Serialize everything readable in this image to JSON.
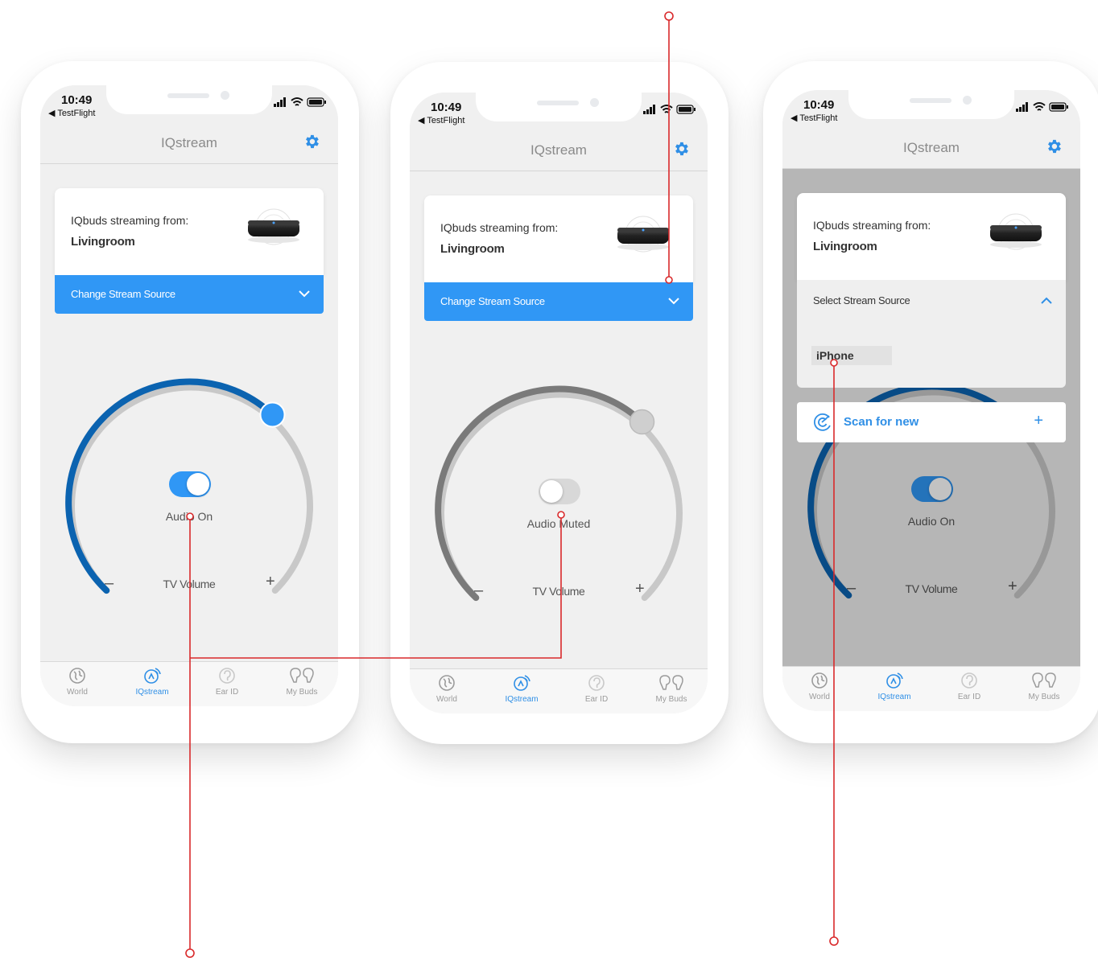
{
  "colors": {
    "accent": "#3097f5",
    "dial_active": "#0b63b0",
    "dial_track": "#c8c8c8",
    "muted_arc": "#7a7a7a",
    "annotation": "#d9292b"
  },
  "phones": [
    {
      "status": {
        "time": "10:49",
        "back": "◀ TestFlight"
      },
      "nav": {
        "title": "IQstream",
        "settings_icon": "gear-icon"
      },
      "card": {
        "label": "IQbuds streaming from:",
        "source": "Livingroom"
      },
      "change_source": {
        "label": "Change Stream Source"
      },
      "volume": {
        "toggle_on": true,
        "audio_label": "Audio On",
        "volume_label": "TV Volume",
        "minus": "–",
        "plus": "+",
        "level": 0.82
      },
      "tabs": [
        {
          "label": "World",
          "icon": "world-icon"
        },
        {
          "label": "IQstream",
          "icon": "iqstream-icon",
          "active": true
        },
        {
          "label": "Ear ID",
          "icon": "ear-id-icon"
        },
        {
          "label": "My Buds",
          "icon": "my-buds-icon"
        }
      ]
    },
    {
      "status": {
        "time": "10:49",
        "back": "◀ TestFlight"
      },
      "nav": {
        "title": "IQstream",
        "settings_icon": "gear-icon"
      },
      "card": {
        "label": "IQbuds streaming from:",
        "source": "Livingroom"
      },
      "change_source": {
        "label": "Change Stream Source"
      },
      "volume": {
        "toggle_on": false,
        "audio_label": "Audio Muted",
        "volume_label": "TV Volume",
        "minus": "–",
        "plus": "+",
        "level": 0.82
      },
      "tabs": [
        {
          "label": "World",
          "icon": "world-icon"
        },
        {
          "label": "IQstream",
          "icon": "iqstream-icon",
          "active": true
        },
        {
          "label": "Ear ID",
          "icon": "ear-id-icon"
        },
        {
          "label": "My Buds",
          "icon": "my-buds-icon"
        }
      ]
    },
    {
      "status": {
        "time": "10:49",
        "back": "◀ TestFlight"
      },
      "nav": {
        "title": "IQstream",
        "settings_icon": "gear-icon"
      },
      "card": {
        "label": "IQbuds streaming from:",
        "source": "Livingroom"
      },
      "dropdown": {
        "title": "Select Stream Source",
        "items": [
          "iPhone"
        ]
      },
      "scan": {
        "label": "Scan for new",
        "plus": "+"
      },
      "volume": {
        "toggle_on": true,
        "audio_label": "Audio On",
        "volume_label": "TV Volume",
        "minus": "–",
        "plus": "+",
        "level": 0.82
      },
      "tabs": [
        {
          "label": "World",
          "icon": "world-icon"
        },
        {
          "label": "IQstream",
          "icon": "iqstream-icon",
          "active": true
        },
        {
          "label": "Ear ID",
          "icon": "ear-id-icon"
        },
        {
          "label": "My Buds",
          "icon": "my-buds-icon"
        }
      ]
    }
  ]
}
